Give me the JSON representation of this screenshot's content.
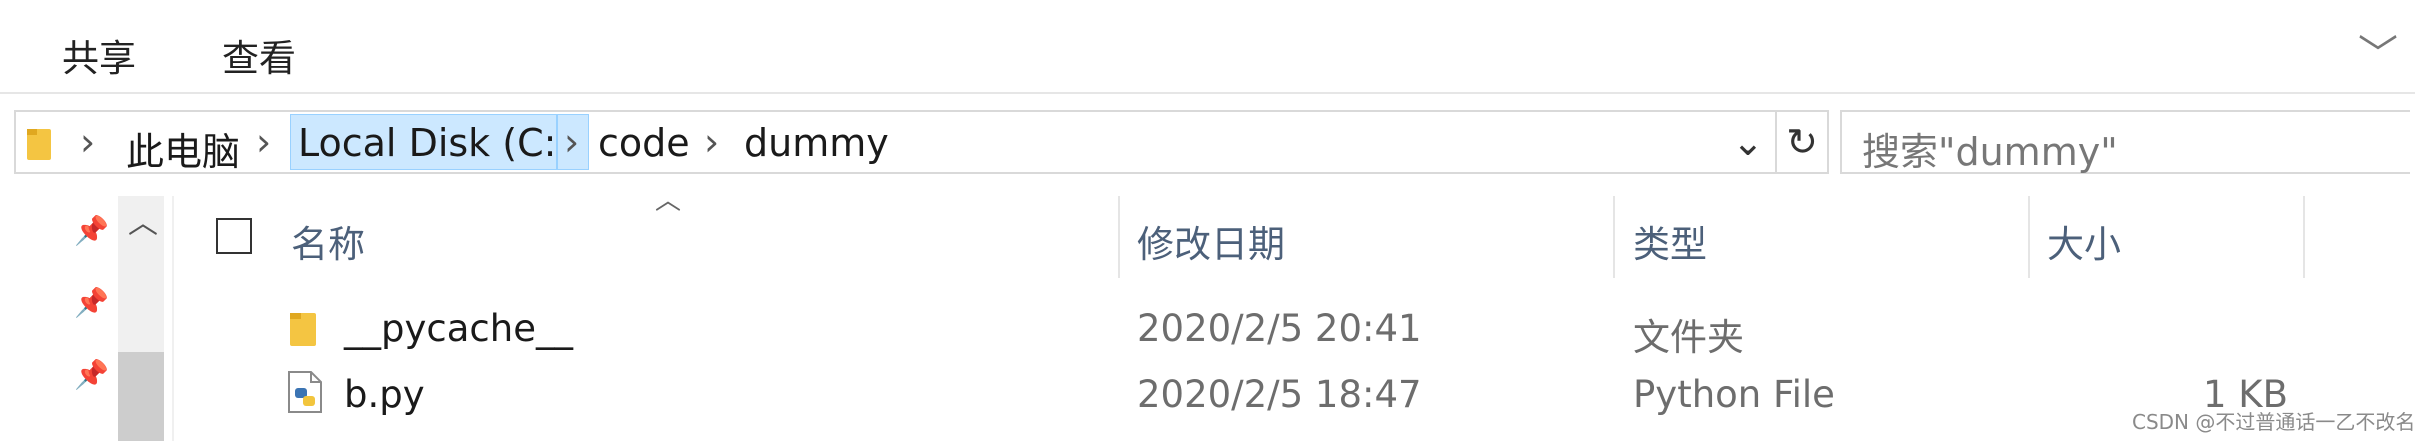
{
  "ribbon": {
    "tabs": [
      "共享",
      "查看"
    ]
  },
  "address_bar": {
    "breadcrumbs": [
      "此电脑",
      "Local Disk (C:)",
      "code",
      "dummy"
    ]
  },
  "search": {
    "placeholder": "搜索\"dummy\""
  },
  "file_list": {
    "columns": [
      "名称",
      "修改日期",
      "类型",
      "大小"
    ],
    "rows": [
      {
        "name": "__pycache__",
        "modified": "2020/2/5 20:41",
        "type": "文件夹",
        "size": "",
        "icon": "folder-icon"
      },
      {
        "name": "b.py",
        "modified": "2020/2/5 18:47",
        "type": "Python File",
        "size": "1 KB",
        "icon": "python-file-icon"
      }
    ]
  },
  "watermark": "CSDN @不过普通话一乙不改名",
  "colors": {
    "breadcrumb_highlight": "#cce8ff",
    "header_text": "#4c607a",
    "folder": "#f4c542"
  }
}
